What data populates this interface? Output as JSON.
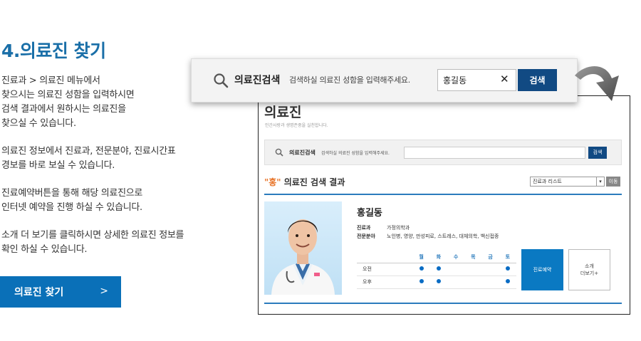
{
  "heading": "4.의료진 찾기",
  "paragraphs": [
    [
      "진료과 > 의료진 메뉴에서",
      "찾으시는 의료진 성함을 입력하시면",
      "검색 결과에서 원하시는 의료진을",
      "찾으실 수 있습니다."
    ],
    [
      "의료진 정보에서 진료과, 전문분야, 진료시간표",
      "경보를 바로 보실 수 있습니다."
    ],
    [
      "진료예약버튼을 통해 해당 의료진으로",
      "인터넷 예약을 진행 하실 수 있습니다."
    ],
    [
      "소개 더 보기를 클릭하시면 상세한 의료진 정보를",
      "확인 하실 수 있습니다."
    ]
  ],
  "cta": {
    "label": "의료진 찾기",
    "chevron": ">"
  },
  "zoom_search": {
    "label": "의료진검색",
    "hint": "검색하실 의료진 성함을 입력해주세요.",
    "value": "홍길동",
    "clear": "✕",
    "button": "검색"
  },
  "page": {
    "title": "의료진",
    "subtitle": "인간사랑과 생명존중을 실천합니다.",
    "search": {
      "label": "의료진검색",
      "hint": "검색하실 의료진 성함을 입력해주세요.",
      "button": "검색"
    },
    "result": {
      "query": "\"홍\"",
      "suffix": " 의료진 검색 결과"
    },
    "select": {
      "selected": "진료과 리스트",
      "arrow": "▾"
    },
    "move_button": "이동",
    "doctor": {
      "name": "홍길동",
      "dept_label": "진료과",
      "dept_value": "가정의학과",
      "field_label": "전문분야",
      "field_value": "노인병, 영양, 만성피로, 스트레스, 대체의학, 백신접종"
    },
    "schedule": {
      "days": [
        "월",
        "화",
        "수",
        "목",
        "금",
        "토"
      ],
      "rows": [
        {
          "label": "오전",
          "slots": [
            true,
            true,
            false,
            false,
            false,
            true
          ]
        },
        {
          "label": "오후",
          "slots": [
            true,
            true,
            false,
            false,
            false,
            true
          ]
        }
      ]
    },
    "reserve_button": "진료예약",
    "more_button": [
      "소개",
      "더보기+"
    ]
  },
  "colors": {
    "accent": "#1a6fa8",
    "button_blue": "#0a70b8",
    "search_button": "#114a83",
    "query_orange": "#e8752a"
  }
}
